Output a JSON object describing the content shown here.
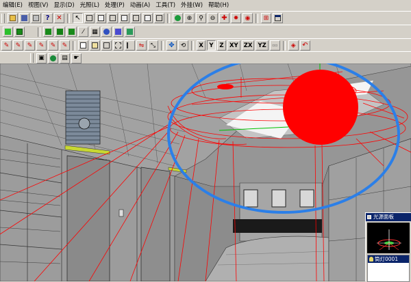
{
  "menu": [
    "编辑(E)",
    "视图(V)",
    "显示(D)",
    "光照(L)",
    "处理(P)",
    "动画(A)",
    "工具(T)",
    "外挂(W)",
    "帮助(H)"
  ],
  "toolbar_axes": [
    "X",
    "Y",
    "Z",
    "XY",
    "ZX",
    "YZ"
  ],
  "light_panel": {
    "title": "光源面板",
    "selected_item": "筒灯0001"
  },
  "colors": {
    "light_wireframe": "#ff0000",
    "light_sphere": "#ff0000",
    "annotation_ellipse": "#2b7fe8",
    "axis_green": "#00c000",
    "scene_gray": "#969696",
    "window_chrome": "#d4d0c8",
    "selection_blue": "#0a246a"
  }
}
